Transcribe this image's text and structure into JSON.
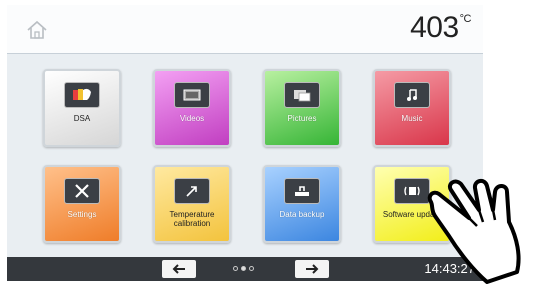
{
  "header": {
    "temperature": "403",
    "temperature_unit": "°C",
    "home_icon": "home-icon"
  },
  "tiles": [
    {
      "label": "DSA",
      "icon": "dsa-icon"
    },
    {
      "label": "Videos",
      "icon": "video-icon"
    },
    {
      "label": "Pictures",
      "icon": "pictures-icon"
    },
    {
      "label": "Music",
      "icon": "music-note-icon"
    },
    {
      "label": "Settings",
      "icon": "tools-icon"
    },
    {
      "label": "Temperature calibration",
      "icon": "calibration-arrow-icon"
    },
    {
      "label": "Data backup",
      "icon": "data-backup-icon"
    },
    {
      "label": "Software update",
      "icon": "software-update-icon"
    }
  ],
  "footer": {
    "prev_icon": "arrow-left-icon",
    "next_icon": "arrow-right-icon",
    "page_count": 3,
    "current_page": 2,
    "time": "14:43:27"
  },
  "colors": {
    "footer_bg": "#34383d",
    "screen_bg": "#e9eef2",
    "dsa": "#d6d6d6",
    "videos": "#c13ec1",
    "pictures": "#36b536",
    "music": "#d9364a",
    "settings": "#ef7d29",
    "temperature_calibration": "#f3c33d",
    "data_backup": "#3c86e0",
    "software_update": "#f2ee1a"
  }
}
